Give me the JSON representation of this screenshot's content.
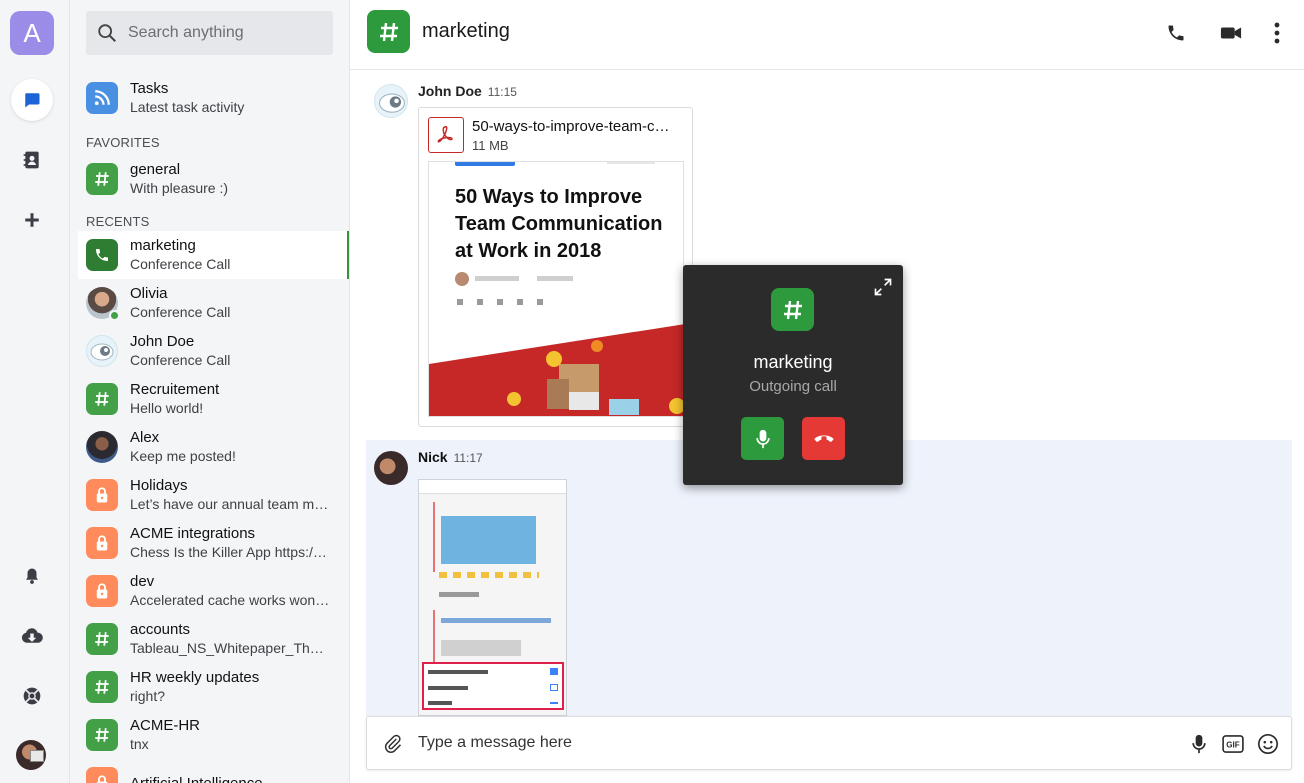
{
  "rail": {
    "workspace_letter": "A"
  },
  "search": {
    "placeholder": "Search anything"
  },
  "tasks": {
    "title": "Tasks",
    "subtitle": "Latest task activity"
  },
  "favorites": {
    "heading": "FAVORITES",
    "items": [
      {
        "title": "general",
        "subtitle": "With pleasure :)"
      }
    ]
  },
  "recents": {
    "heading": "RECENTS",
    "items": [
      {
        "title": "marketing",
        "subtitle": "Conference Call"
      },
      {
        "title": "Olivia",
        "subtitle": "Conference Call"
      },
      {
        "title": "John Doe",
        "subtitle": "Conference Call"
      },
      {
        "title": "Recruitement",
        "subtitle": "Hello world!"
      },
      {
        "title": "Alex",
        "subtitle": "Keep me posted!"
      },
      {
        "title": "Holidays",
        "subtitle": "Let’s have our annual team m…"
      },
      {
        "title": "ACME integrations",
        "subtitle": "Chess Is the Killer App https:/…"
      },
      {
        "title": "dev",
        "subtitle": "Accelerated cache works won…"
      },
      {
        "title": "accounts",
        "subtitle": "Tableau_NS_Whitepaper_The_…"
      },
      {
        "title": "HR weekly updates",
        "subtitle": "right?"
      },
      {
        "title": "ACME-HR",
        "subtitle": "tnx"
      },
      {
        "title": "Artificial Intelligence",
        "subtitle": ""
      }
    ]
  },
  "header": {
    "channel_name": "marketing"
  },
  "messages": [
    {
      "author": "John Doe",
      "time": "11:15",
      "file": {
        "name": "50-ways-to-improve-team-c…",
        "size": "11 MB",
        "preview_title": "50 Ways to Improve Team Communication at Work in 2018"
      }
    },
    {
      "author": "Nick",
      "time": "11:17"
    }
  ],
  "composer": {
    "placeholder": "Type a message here"
  },
  "call": {
    "channel_name": "marketing",
    "status": "Outgoing call"
  },
  "colors": {
    "accent_green": "#2e9a3e",
    "end_red": "#e53935",
    "lock_orange": "#ff8a5b"
  }
}
